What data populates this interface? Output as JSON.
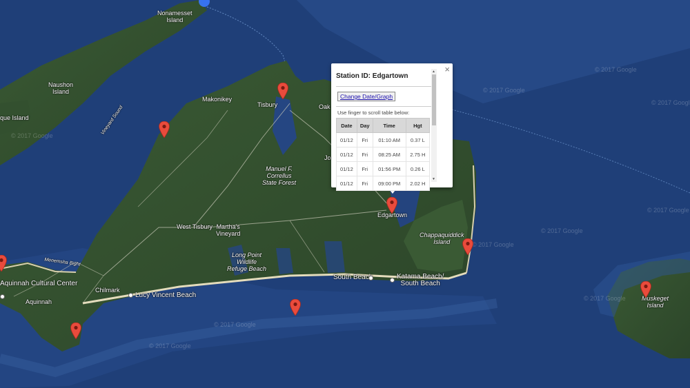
{
  "map": {
    "colors": {
      "water_deep": "#1f3f78",
      "water_shelf": "#2a5292",
      "land": "#2f4a2c",
      "land_light": "#3e5a36",
      "beach": "#d8cfae",
      "marker": "#e94b3c"
    },
    "place_labels": [
      {
        "id": "nonamesset",
        "text": "Nonamesset\nIsland"
      },
      {
        "id": "naushon",
        "text": "Naushon\nIsland"
      },
      {
        "id": "pasque",
        "text": "que Island"
      },
      {
        "id": "vineyard-sound",
        "text": "Vineyard Sound"
      },
      {
        "id": "makonikey",
        "text": "Makonikey"
      },
      {
        "id": "tisbury",
        "text": "Tisbury"
      },
      {
        "id": "oak",
        "text": "Oak"
      },
      {
        "id": "jo",
        "text": "Jo"
      },
      {
        "id": "manuel",
        "text": "Manuel F.\nCorrellus\nState Forest"
      },
      {
        "id": "west-tisbury",
        "text": "West Tisbury"
      },
      {
        "id": "marthas",
        "text": "Martha's\nVineyard"
      },
      {
        "id": "long-point",
        "text": "Long Point\nWildlife\nRefuge Beach"
      },
      {
        "id": "edgartown",
        "text": "Edgartown"
      },
      {
        "id": "chappaquiddick",
        "text": "Chappaquiddick\nIsland"
      },
      {
        "id": "menemsha",
        "text": "Menemsha Bight"
      },
      {
        "id": "aquinnah-cc",
        "text": "Aquinnah Cultural Center"
      },
      {
        "id": "aquinnah",
        "text": "Aquinnah"
      },
      {
        "id": "chilmark",
        "text": "Chilmark"
      },
      {
        "id": "lucy",
        "text": "Lucy Vincent Beach"
      },
      {
        "id": "south-beach",
        "text": "South Beach"
      },
      {
        "id": "katama",
        "text": "Katama Beach/\nSouth Beach"
      },
      {
        "id": "muskeget",
        "text": "Muskeget\nIsland"
      }
    ],
    "watermarks": [
      "© 2017 Google",
      "© 2017 Google",
      "© 2017 Google",
      "© 2017 Google",
      "© 2017 Google",
      "© 2017 Google",
      "© 2017 Google",
      "© 2017 Google",
      "© 2017 Google",
      "© 2017 Google"
    ]
  },
  "popup": {
    "title": "Station ID: Edgartown",
    "change_button": "Change Date/Graph",
    "scroll_hint": "Use finger to scroll table below:",
    "close_label": "×",
    "columns": [
      "Date",
      "Day",
      "Time",
      "Hgt"
    ],
    "rows": [
      [
        "01/12",
        "Fri",
        "01:10 AM",
        "0.37 L"
      ],
      [
        "01/12",
        "Fri",
        "08:25 AM",
        "2.75 H"
      ],
      [
        "01/12",
        "Fri",
        "01:56 PM",
        "0.26 L"
      ],
      [
        "01/12",
        "Fri",
        "09:00 PM",
        "2.02 H"
      ]
    ]
  }
}
